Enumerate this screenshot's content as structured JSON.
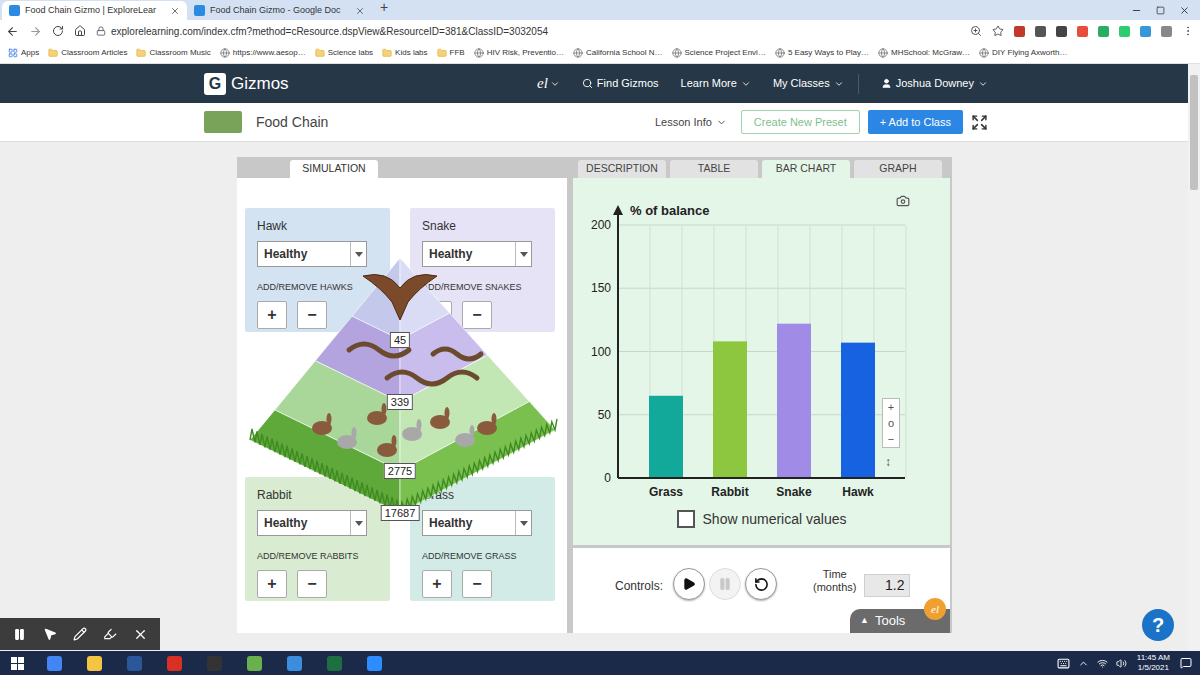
{
  "browser": {
    "tabs": [
      {
        "title": "Food Chain Gizmo | ExploreLear",
        "selected": true
      },
      {
        "title": "Food Chain Gizmo - Google Doc",
        "selected": false
      }
    ],
    "new_tab": "+",
    "url": "explorelearning.com/index.cfm?method=cResource.dspView&ResourceID=381&ClassID=3032054",
    "bookmarks": [
      {
        "label": "Apps",
        "kind": "apps"
      },
      {
        "label": "Classroom Articles",
        "kind": "folder"
      },
      {
        "label": "Classroom Music",
        "kind": "folder"
      },
      {
        "label": "https://www.aesop…",
        "kind": "link"
      },
      {
        "label": "Science labs",
        "kind": "folder"
      },
      {
        "label": "Kids labs",
        "kind": "folder"
      },
      {
        "label": "FFB",
        "kind": "folder"
      },
      {
        "label": "HIV Risk, Preventio…",
        "kind": "link"
      },
      {
        "label": "California School N…",
        "kind": "link"
      },
      {
        "label": "Science Project Envi…",
        "kind": "link"
      },
      {
        "label": "5 Easy Ways to Play…",
        "kind": "link"
      },
      {
        "label": "MHSchool: McGraw…",
        "kind": "link"
      },
      {
        "label": "DIY Flying Axworth…",
        "kind": "link"
      }
    ]
  },
  "header": {
    "logo_mark": "G",
    "logo_text": "Gizmos",
    "el_logo": "el",
    "nav": [
      {
        "label": "Find Gizmos",
        "kind": "search"
      },
      {
        "label": "Learn More",
        "kind": "menu"
      },
      {
        "label": "My Classes",
        "kind": "menu"
      },
      {
        "label": "Joshua Downey",
        "kind": "user"
      }
    ]
  },
  "subheader": {
    "title": "Food Chain",
    "lesson_info": "Lesson Info",
    "create_preset": "Create New Preset",
    "add_to_class": "+ Add to Class"
  },
  "gizmo": {
    "left_tabs": [
      {
        "label": "SIMULATION",
        "selected": true
      }
    ],
    "right_tabs": [
      {
        "label": "DESCRIPTION",
        "selected": false
      },
      {
        "label": "TABLE",
        "selected": false
      },
      {
        "label": "BAR CHART",
        "selected": true
      },
      {
        "label": "GRAPH",
        "selected": false
      }
    ],
    "species": [
      {
        "name": "Hawk",
        "status": "Healthy",
        "action": "ADD/REMOVE HAWKS",
        "add": "+",
        "remove": "−",
        "count": "45",
        "color": "#d3e3f2"
      },
      {
        "name": "Snake",
        "status": "Healthy",
        "action": "ADD/REMOVE SNAKES",
        "add": "+",
        "remove": "−",
        "count": "339",
        "color": "#e6e3f7"
      },
      {
        "name": "Rabbit",
        "status": "Healthy",
        "action": "ADD/REMOVE RABBITS",
        "add": "+",
        "remove": "−",
        "count": "2775",
        "color": "#d9ecd2"
      },
      {
        "name": "Grass",
        "status": "Healthy",
        "action": "ADD/REMOVE GRASS",
        "add": "+",
        "remove": "−",
        "count": "17687",
        "color": "#d2ebe6"
      }
    ],
    "chart": {
      "title": "% of balance",
      "y_ticks": [
        "200",
        "150",
        "100",
        "50",
        "0"
      ],
      "categories": [
        {
          "label": "Grass",
          "color": "#12a89a"
        },
        {
          "label": "Rabbit",
          "color": "#8dc63f"
        },
        {
          "label": "Snake",
          "color": "#a08ce6"
        },
        {
          "label": "Hawk",
          "color": "#1662e0"
        }
      ],
      "series": [
        {
          "values": [
            65,
            108,
            122,
            107
          ]
        }
      ]
    },
    "checkbox": {
      "label": "Show numerical values",
      "checked": false
    },
    "zoom": [
      "+",
      "o",
      "−"
    ],
    "zoom_resize": "↕",
    "controls": {
      "label": "Controls:",
      "buttons": [
        {
          "kind": "play",
          "disabled": false
        },
        {
          "kind": "pause",
          "disabled": true
        },
        {
          "kind": "reset",
          "disabled": false
        }
      ],
      "time_label": [
        "Time",
        "(months)"
      ],
      "time_value": "1.2"
    },
    "tools": {
      "label": "Tools",
      "arrow": "▲",
      "badge": "el"
    }
  },
  "annotation_toolbar": [
    {
      "kind": "pause"
    },
    {
      "kind": "pointer"
    },
    {
      "kind": "pen"
    },
    {
      "kind": "highlighter"
    },
    {
      "kind": "close"
    }
  ],
  "help": "?",
  "taskbar": {
    "time": "11:45 AM",
    "date": "1/5/2021"
  }
}
